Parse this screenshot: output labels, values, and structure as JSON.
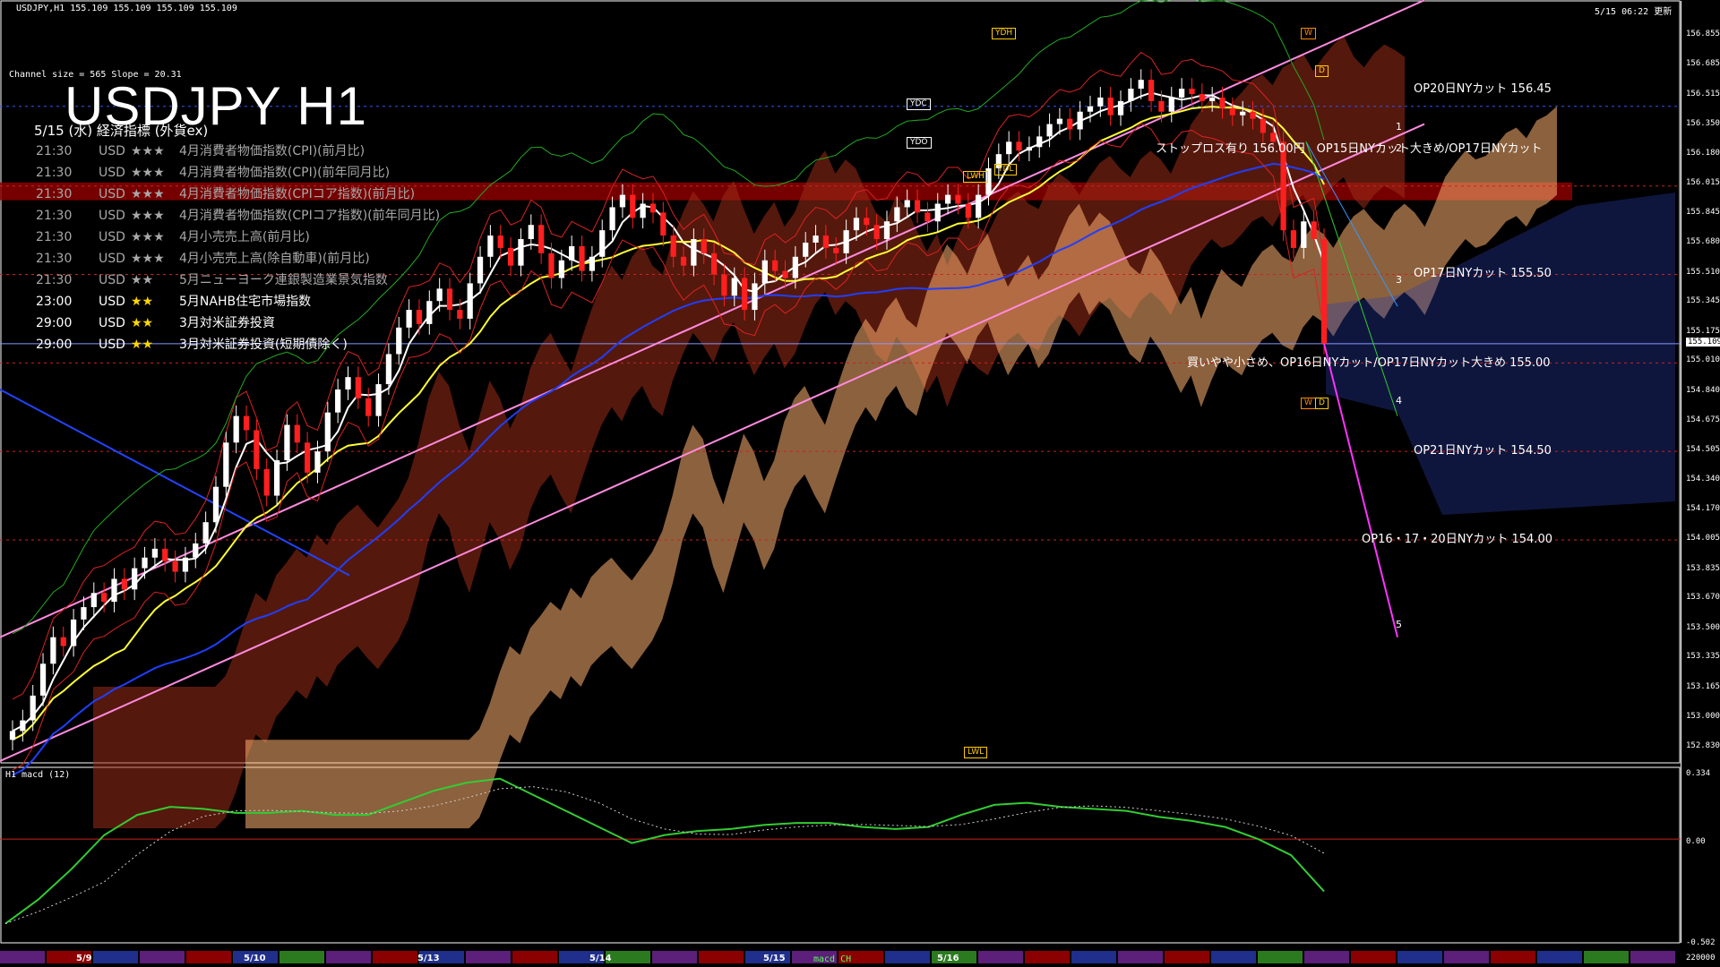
{
  "header": {
    "info": "USDJPY,H1  155.109 155.109 155.109 155.109",
    "updated": "5/15 06:22 更新",
    "channel": "Channel size = 565 Slope = 20.31",
    "title": "USDJPY H1",
    "subtitle": "5/15 (水) 経済指標 (外貨ex)"
  },
  "events": [
    {
      "time": "21:30",
      "cur": "USD",
      "stars": "★★★",
      "name": "4月消費者物価指数(CPI)(前月比)",
      "past": true
    },
    {
      "time": "21:30",
      "cur": "USD",
      "stars": "★★★",
      "name": "4月消費者物価指数(CPI)(前年同月比)",
      "past": true
    },
    {
      "time": "21:30",
      "cur": "USD",
      "stars": "★★★",
      "name": "4月消費者物価指数(CPIコア指数)(前月比)",
      "past": true
    },
    {
      "time": "21:30",
      "cur": "USD",
      "stars": "★★★",
      "name": "4月消費者物価指数(CPIコア指数)(前年同月比)",
      "past": true
    },
    {
      "time": "21:30",
      "cur": "USD",
      "stars": "★★★",
      "name": "4月小売売上高(前月比)",
      "past": true
    },
    {
      "time": "21:30",
      "cur": "USD",
      "stars": "★★★",
      "name": "4月小売売上高(除自動車)(前月比)",
      "past": true
    },
    {
      "time": "21:30",
      "cur": "USD",
      "stars": "★★",
      "name": "5月ニューヨーク連銀製造業景気指数",
      "past": true
    },
    {
      "time": "23:00",
      "cur": "USD",
      "stars": "★★",
      "name": "5月NAHB住宅市場指数",
      "past": false
    },
    {
      "time": "29:00",
      "cur": "USD",
      "stars": "★★",
      "name": "3月対米証券投資",
      "past": false
    },
    {
      "time": "29:00",
      "cur": "USD",
      "stars": "★★",
      "name": "3月対米証券投資(短期債除く)",
      "past": false
    }
  ],
  "levels": {
    "op20": "OP20日NYカット 156.45",
    "stop": "ストップロス有り 156.00円　OP15日NYカット大きめ/OP17日NYカット",
    "op17": "OP17日NYカット 155.50",
    "buy": "買いやや小さめ、OP16日NYカット/OP17日NYカット大きめ 155.00",
    "op21": "OP21日NYカット 154.50",
    "op161720": "OP16・17・20日NYカット 154.00"
  },
  "tags": {
    "ydh": "YDH",
    "ydc": "YDC",
    "ydo": "YDO",
    "ydl": "YDL",
    "lwh": "LWH",
    "lwl": "LWL",
    "w": "W",
    "d": "D",
    "n1": "1",
    "n2": "2",
    "n3": "3",
    "n4": "4",
    "n5": "5"
  },
  "macd": {
    "label": "H1  macd (12)",
    "ticks": [
      "0.334",
      "0.00",
      "-0.502",
      "220000"
    ],
    "footer": "macd CH"
  },
  "dates": [
    "5/9",
    "5/10",
    "5/13",
    "5/14",
    "5/15",
    "5/16"
  ],
  "colors": {
    "bull": "#ffffff",
    "bear": "#ff1f1f",
    "cloud_orange": "#ffb070",
    "cloud_red": "#9a2b17",
    "cloud_blue": "#2a3fb0",
    "channel": "#ff8adf",
    "ma_white": "#ffffff",
    "ma_yellow": "#ffff33",
    "ma_blue": "#1f3fff",
    "macd_green": "#33cc33",
    "macd_pink": "#ff7fbf",
    "stop_band": "#8b0000"
  },
  "chart_data": {
    "type": "candlestick",
    "symbol": "USDJPY",
    "timeframe": "H1",
    "ylim": [
      152.75,
      156.95
    ],
    "y_ticks": [
      156.855,
      156.685,
      156.515,
      156.35,
      156.18,
      156.015,
      155.845,
      155.68,
      155.51,
      155.345,
      155.175,
      155.01,
      154.84,
      154.675,
      154.505,
      154.34,
      154.17,
      154.005,
      153.835,
      153.67,
      153.5,
      153.335,
      153.165,
      153.0,
      152.83
    ],
    "last_price": 155.109,
    "levels": [
      156.45,
      156.0,
      155.5,
      155.0,
      154.5,
      154.0
    ],
    "closes": [
      152.92,
      152.98,
      153.12,
      153.3,
      153.45,
      153.4,
      153.55,
      153.62,
      153.7,
      153.65,
      153.78,
      153.72,
      153.84,
      153.9,
      153.95,
      153.88,
      153.82,
      153.9,
      153.98,
      154.1,
      154.3,
      154.55,
      154.7,
      154.62,
      154.4,
      154.25,
      154.45,
      154.65,
      154.55,
      154.38,
      154.5,
      154.72,
      154.85,
      154.92,
      154.8,
      154.7,
      154.88,
      155.05,
      155.2,
      155.3,
      155.22,
      155.35,
      155.42,
      155.3,
      155.25,
      155.45,
      155.6,
      155.72,
      155.65,
      155.55,
      155.7,
      155.78,
      155.62,
      155.48,
      155.58,
      155.66,
      155.52,
      155.6,
      155.75,
      155.88,
      155.95,
      155.82,
      155.9,
      155.85,
      155.72,
      155.6,
      155.55,
      155.7,
      155.62,
      155.5,
      155.38,
      155.48,
      155.3,
      155.45,
      155.58,
      155.52,
      155.48,
      155.6,
      155.68,
      155.72,
      155.65,
      155.62,
      155.75,
      155.82,
      155.78,
      155.7,
      155.8,
      155.88,
      155.92,
      155.85,
      155.8,
      155.9,
      155.95,
      155.9,
      155.82,
      155.95,
      156.1,
      156.18,
      156.25,
      156.2,
      156.22,
      156.28,
      156.35,
      156.38,
      156.32,
      156.42,
      156.45,
      156.5,
      156.4,
      156.48,
      156.55,
      156.6,
      156.48,
      156.42,
      156.5,
      156.55,
      156.52,
      156.48,
      156.5,
      156.44,
      156.4,
      156.42,
      156.38,
      156.3,
      156.25,
      155.75,
      155.65,
      155.8,
      155.7,
      155.109
    ],
    "macd": [
      -0.42,
      -0.3,
      -0.15,
      0.02,
      0.12,
      0.16,
      0.15,
      0.13,
      0.13,
      0.14,
      0.12,
      0.12,
      0.18,
      0.24,
      0.28,
      0.3,
      0.22,
      0.14,
      0.06,
      -0.02,
      0.02,
      0.04,
      0.05,
      0.07,
      0.08,
      0.08,
      0.06,
      0.05,
      0.06,
      0.12,
      0.17,
      0.18,
      0.16,
      0.15,
      0.14,
      0.11,
      0.09,
      0.06,
      0.0,
      -0.08,
      -0.26
    ]
  }
}
